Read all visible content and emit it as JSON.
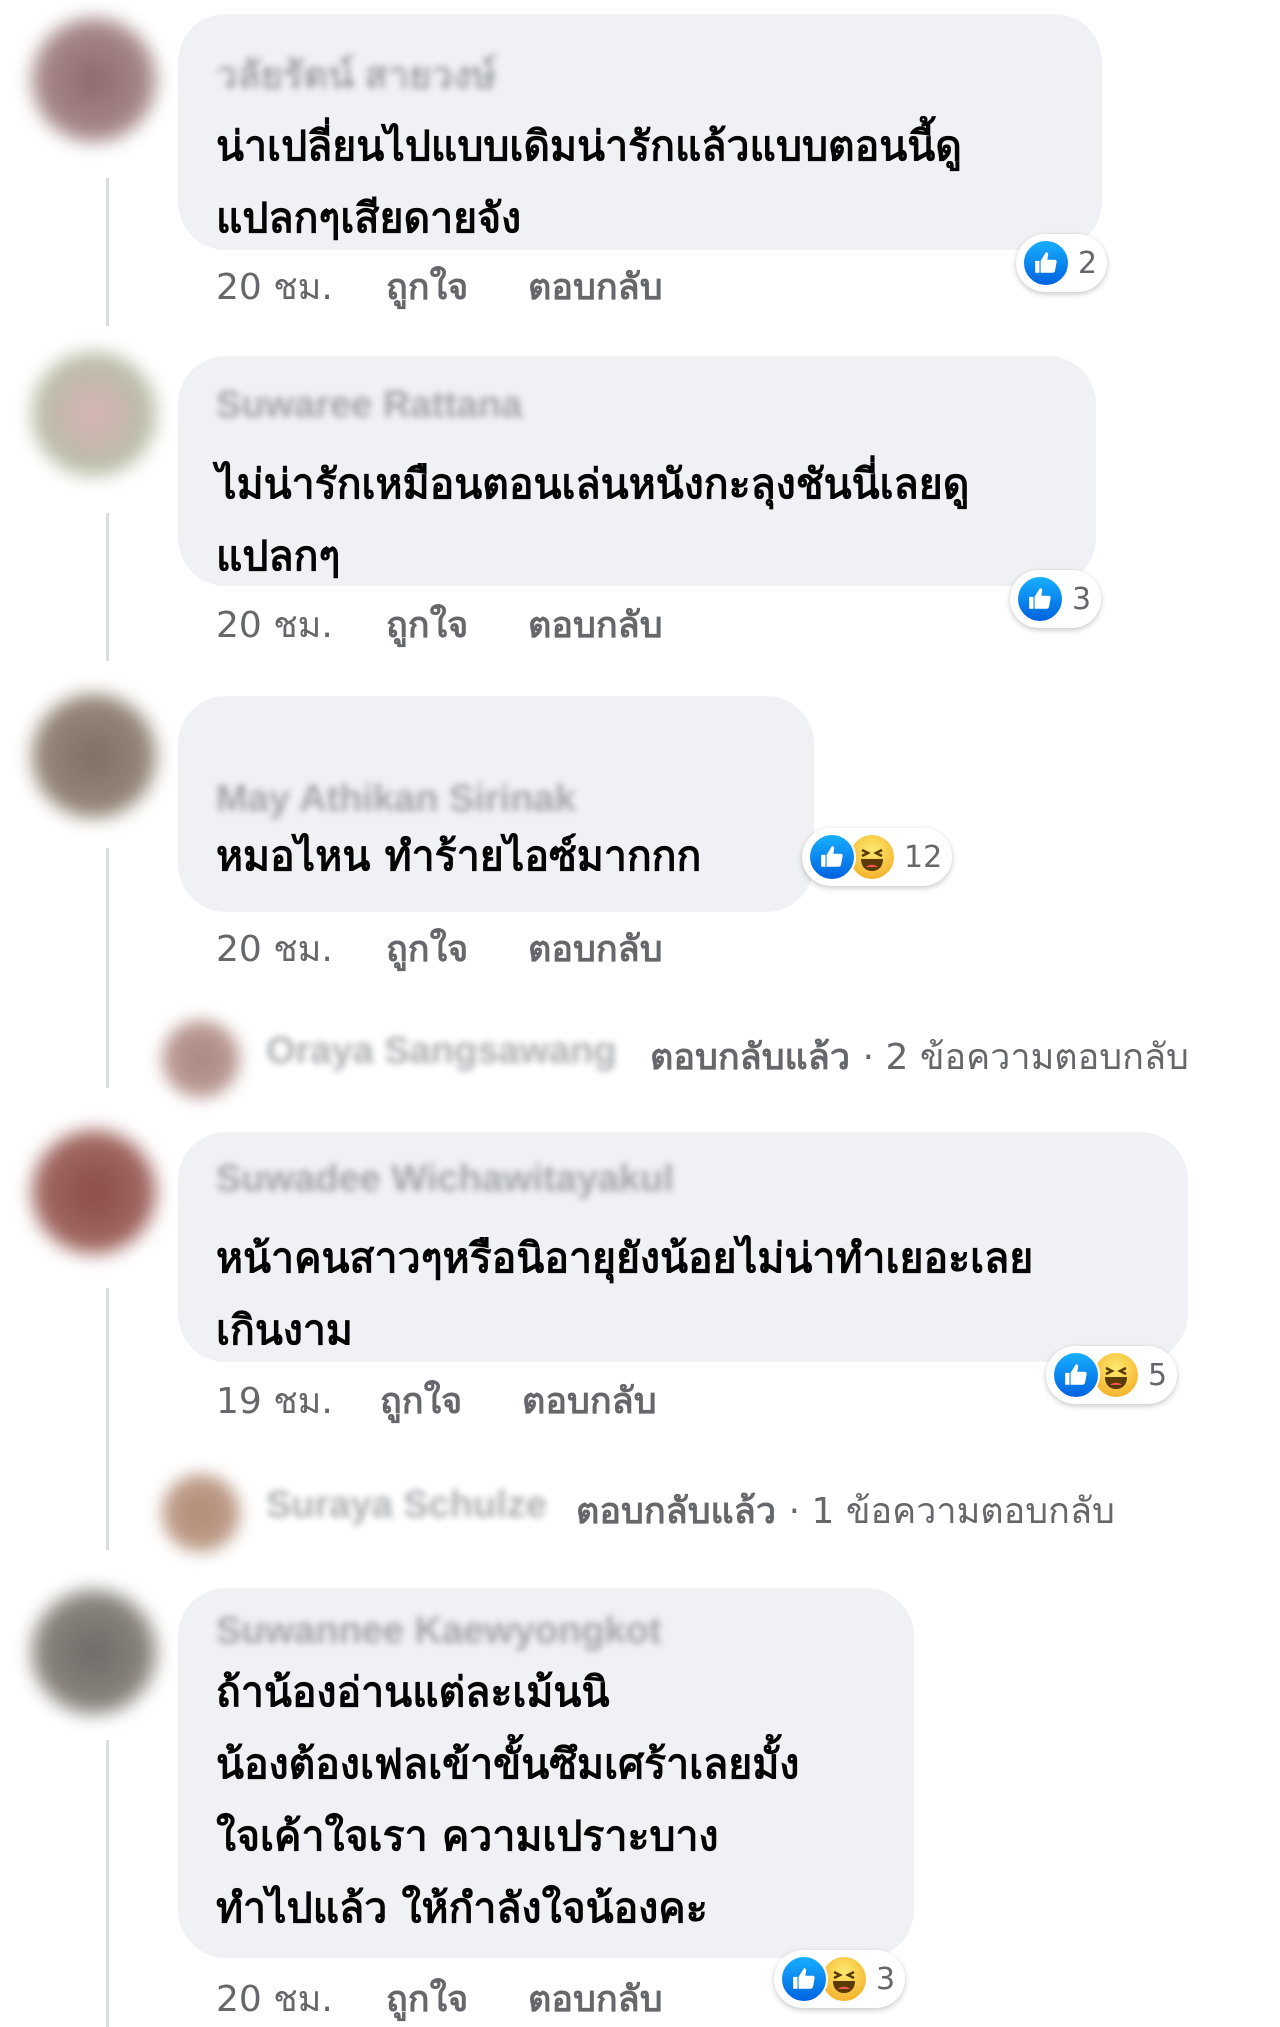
{
  "comments": [
    {
      "author": "วลัยรัตน์ สายวงษ์",
      "text": "น่าเปลี่ยนไปแบบเดิมน่ารักแล้วแบบตอนนี้ดู\nแปลกๆเสียดายจัง",
      "time": "20 ชม.",
      "like_label": "ถูกใจ",
      "reply_label": "ตอบกลับ",
      "reaction_count": "2",
      "reaction_icons": [
        "like-icon"
      ]
    },
    {
      "author": "Suwaree Rattana",
      "text": "ไม่น่ารักเหมือนตอนเล่นหนังกะลุงชันนี่เลยดู\nแปลกๆ",
      "time": "20 ชม.",
      "like_label": "ถูกใจ",
      "reply_label": "ตอบกลับ",
      "reaction_count": "3",
      "reaction_icons": [
        "like-icon"
      ]
    },
    {
      "author": "May Athikan Sirinak",
      "text": "หมอไหน  ทำร้ายไอซ์มากกก",
      "time": "20 ชม.",
      "like_label": "ถูกใจ",
      "reply_label": "ตอบกลับ",
      "reaction_count": "12",
      "reaction_icons": [
        "like-icon",
        "haha-icon"
      ],
      "replies_summary": {
        "name": "Oraya Sangsawang",
        "action": "ตอบกลับแล้ว",
        "separator": "·",
        "count_text": "2 ข้อความตอบกลับ"
      }
    },
    {
      "author": "Suwadee Wichawitayakul",
      "text": "หน้าคนสาวๆหรือนิอายุยังน้อยไม่น่าทำเยอะเลย\nเกินงาม",
      "time": "19 ชม.",
      "like_label": "ถูกใจ",
      "reply_label": "ตอบกลับ",
      "reaction_count": "5",
      "reaction_icons": [
        "like-icon",
        "haha-icon"
      ],
      "replies_summary": {
        "name": "Suraya Schulze",
        "action": "ตอบกลับแล้ว",
        "separator": "·",
        "count_text": "1 ข้อความตอบกลับ"
      }
    },
    {
      "author": "Suwannee Kaewyongkot",
      "text": "ถ้าน้องอ่านแต่ละเม้นนิ\nน้องต้องเฟลเข้าขั้นซึมเศร้าเลยมั้ง\nใจเค้าใจเรา ความเปราะบาง\nทำไปแล้ว ให้กำลังใจน้องคะ",
      "time": "20 ชม.",
      "like_label": "ถูกใจ",
      "reply_label": "ตอบกลับ",
      "reaction_count": "3",
      "reaction_icons": [
        "like-icon",
        "haha-icon"
      ]
    }
  ],
  "colors": {
    "bubble": "#eff1f4",
    "meta_text": "#65676b",
    "like_blue": "#1877f2",
    "haha_yellow": "#f7b928"
  }
}
